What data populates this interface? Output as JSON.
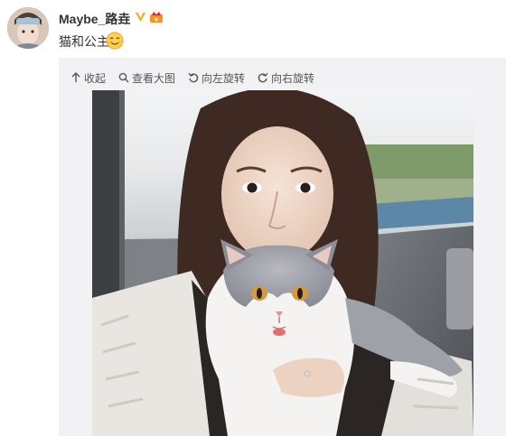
{
  "post": {
    "username": "Maybe_路垚",
    "text": "猫和公主",
    "emoji_icon": "smile-face-icon",
    "verified_icon": "verified-v-icon",
    "vip_icon": "vip-crown-icon"
  },
  "toolbar": {
    "collapse": "收起",
    "view_large": "查看大图",
    "rotate_left": "向左旋转",
    "rotate_right": "向右旋转"
  },
  "colors": {
    "username": "#333333",
    "verified": "#f5a623",
    "vip": "#f7931e",
    "toolbar_bg": "#f2f2f5"
  }
}
